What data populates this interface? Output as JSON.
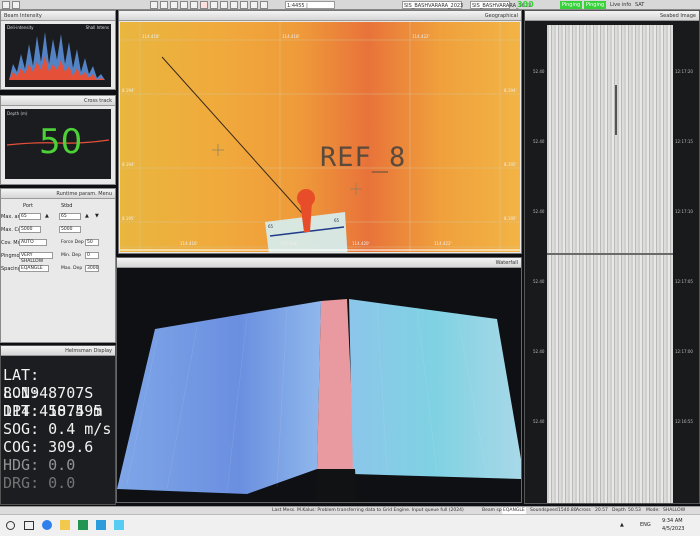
{
  "toolbar": {
    "file_tab": "SIS_BASHVARARA_2023",
    "scale_value": "1:4455 | 8.19k(14.425)",
    "status_value": "300",
    "mode_a": "Pinging",
    "mode_b": "Pinging",
    "live_label": "Live info",
    "sat_label": "SAT",
    "right_tab": "SIS_BASHVARARA_2023"
  },
  "left_panels": {
    "beam_title": "Beam Intensity",
    "beam_sub": "Deli-intensity",
    "beam_sub_right": "Shall Intens",
    "cross_title": "Cross track",
    "cross_sub": "Depth (m)",
    "depth_big": "50",
    "runtime_title": "Runtime param. Menu",
    "port_label": "Port",
    "stbd_label": "Stbd",
    "rows": [
      {
        "label": "Max. angl",
        "port": "65",
        "stbd": "65"
      },
      {
        "label": "Max. Cov",
        "port": "5000",
        "stbd": "5000"
      },
      {
        "label": "Cov. Mode",
        "port": "AUTO",
        "stbd": ""
      },
      {
        "label": "Pingmode",
        "port": "VERY SHALLOW",
        "stbd": ""
      },
      {
        "label": "Spacing",
        "port": "EQANGLE",
        "stbd": ""
      }
    ],
    "right_fields": [
      {
        "label": "Force Dep",
        "value": "50"
      },
      {
        "label": "Min. Dep",
        "value": "0"
      },
      {
        "label": "Max. Dep",
        "value": "3000"
      }
    ],
    "helmsman_title": "Helmsman Display",
    "nav": [
      {
        "key": "LAT:",
        "value": "8.1948707S"
      },
      {
        "key": "LON:",
        "value": "114.4187495"
      },
      {
        "key": "DPT:",
        "value": "50.5 m"
      },
      {
        "key": "SOG:",
        "value": "0.4 m/s"
      },
      {
        "key": "COG:",
        "value": "309.6"
      },
      {
        "key": "HDG:",
        "value": "0.0"
      },
      {
        "key": "DRG:",
        "value": "0.0"
      }
    ]
  },
  "geo": {
    "title": "Geographical",
    "ref_label": "REF_8",
    "grid_top": [
      "114.418'",
      "114.418'",
      "114.422'"
    ],
    "grid_bottom": [
      "114.416'",
      "114.418'",
      "114.420'",
      "114.422'"
    ],
    "grid_left": [
      "8.194'",
      "8.194'",
      "8.195'"
    ],
    "grid_right": [
      "8.194'",
      "8.195'",
      "8.195'"
    ],
    "chart_labels": [
      "65",
      "65"
    ]
  },
  "waterfall": {
    "title": "Waterfall"
  },
  "seabed": {
    "title": "Seabed Image",
    "ticks_left": [
      "52.40",
      "52.40",
      "52.40",
      "52.40",
      "52.40",
      "52.40"
    ],
    "ticks_right": [
      "12:17:20",
      "12:17:15",
      "12:17:10",
      "12:17:05",
      "12:17:00",
      "12:16:55"
    ]
  },
  "status_bar": {
    "last_message": "Last Mess. M.Kalus: Problem transferring data to Grid Engine. Input queue full (2024)",
    "beam_label": "Beam sp.",
    "beam_value": "EQANGLE",
    "sound_label": "Soundspeed",
    "sound_value": "1540.80",
    "across_label": "Across",
    "across_value": "20.57",
    "depth_label": "Depth",
    "depth_value": "50.53",
    "mode_label": "Mode:",
    "mode_value": "SHALLOW"
  },
  "taskbar": {
    "time": "9:34 AM",
    "date": "4/5/2023",
    "lang": "ENG"
  },
  "colors": {
    "accent_green": "#37d13a",
    "depth_green": "#4cd137",
    "ref_text": "#5a4a3c"
  }
}
